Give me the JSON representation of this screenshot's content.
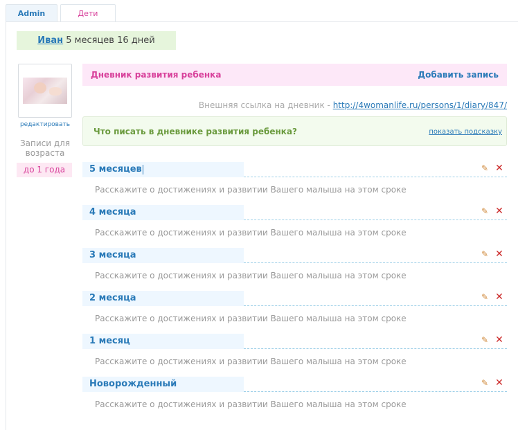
{
  "tabs": [
    {
      "label": "Admin"
    },
    {
      "label": "Дети"
    }
  ],
  "child": {
    "name": "Иван",
    "age": "5 месяцев 16 дней"
  },
  "sidebar": {
    "edit_label": "редактировать",
    "records_for_age": "Записи для возраста",
    "age_badge": "до 1 года"
  },
  "diary": {
    "title": "Дневник развития ребенка",
    "add_entry": "Добавить запись",
    "external_link_label": "Внешняя ссылка на дневник -",
    "external_link_url": "http://4womanlife.ru/persons/1/diary/847/",
    "hint_question": "Что писать в дневнике развития ребенка?",
    "hint_show": "показать подсказку"
  },
  "entries": [
    {
      "title": "5 месяцев",
      "desc": "Расскажите о достижениях и развитии Вашего малыша на этом сроке"
    },
    {
      "title": "4 месяца",
      "desc": "Расскажите о достижениях и развитии Вашего малыша на этом сроке"
    },
    {
      "title": "3 месяца",
      "desc": "Расскажите о достижениях и развитии Вашего малыша на этом сроке"
    },
    {
      "title": "2 месяца",
      "desc": "Расскажите о достижениях и развитии Вашего малыша на этом сроке"
    },
    {
      "title": "1 месяц",
      "desc": "Расскажите о достижениях и развитии Вашего малыша на этом сроке"
    },
    {
      "title": "Новорожденный",
      "desc": "Расскажите о достижениях и развитии Вашего малыша на этом сроке"
    }
  ],
  "icons": {
    "edit": "pencil-icon",
    "delete": "cross-icon"
  },
  "colors": {
    "accent_pink": "#d8419b",
    "link_blue": "#2a7ab8",
    "hint_green": "#6a9a3d",
    "delete_red": "#cc2b2b"
  }
}
